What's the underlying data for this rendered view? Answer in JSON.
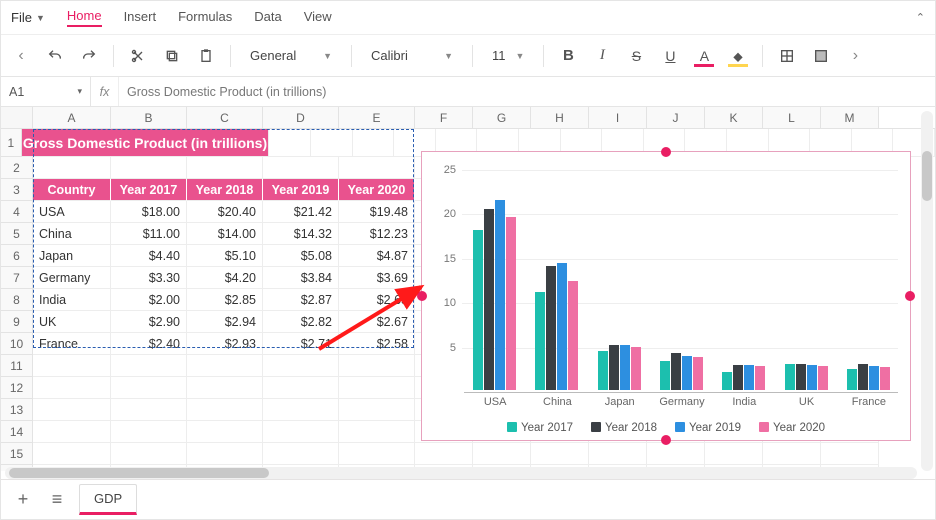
{
  "menu": {
    "file": "File",
    "items": [
      "Home",
      "Insert",
      "Formulas",
      "Data",
      "View"
    ],
    "activeIndex": 0
  },
  "toolbar": {
    "numberFormat": "General",
    "fontName": "Calibri",
    "fontSize": "11"
  },
  "formula": {
    "cellRef": "A1",
    "fx": "fx",
    "value": "Gross Domestic Product (in trillions)"
  },
  "columns": [
    "A",
    "B",
    "C",
    "D",
    "E",
    "F",
    "G",
    "H",
    "I",
    "J",
    "K",
    "L",
    "M"
  ],
  "rowCount": 16,
  "table": {
    "title": "Gross Domestic Product (in trillions)",
    "headers": [
      "Country",
      "Year 2017",
      "Year 2018",
      "Year 2019",
      "Year 2020"
    ],
    "rows": [
      [
        "USA",
        "$18.00",
        "$20.40",
        "$21.42",
        "$19.48"
      ],
      [
        "China",
        "$11.00",
        "$14.00",
        "$14.32",
        "$12.23"
      ],
      [
        "Japan",
        "$4.40",
        "$5.10",
        "$5.08",
        "$4.87"
      ],
      [
        "Germany",
        "$3.30",
        "$4.20",
        "$3.84",
        "$3.69"
      ],
      [
        "India",
        "$2.00",
        "$2.85",
        "$2.87",
        "$2.65"
      ],
      [
        "UK",
        "$2.90",
        "$2.94",
        "$2.82",
        "$2.67"
      ],
      [
        "France",
        "$2.40",
        "$2.93",
        "$2.71",
        "$2.58"
      ]
    ]
  },
  "sheet": {
    "name": "GDP"
  },
  "chart_data": {
    "type": "bar",
    "categories": [
      "USA",
      "China",
      "Japan",
      "Germany",
      "India",
      "UK",
      "France"
    ],
    "series": [
      {
        "name": "Year 2017",
        "color": "#1cbfae",
        "values": [
          18.0,
          11.0,
          4.4,
          3.3,
          2.0,
          2.9,
          2.4
        ]
      },
      {
        "name": "Year 2018",
        "color": "#3a3f44",
        "values": [
          20.4,
          14.0,
          5.1,
          4.2,
          2.85,
          2.94,
          2.93
        ]
      },
      {
        "name": "Year 2019",
        "color": "#2d8fe0",
        "values": [
          21.42,
          14.32,
          5.08,
          3.84,
          2.87,
          2.82,
          2.71
        ]
      },
      {
        "name": "Year 2020",
        "color": "#ef6fa3",
        "values": [
          19.48,
          12.23,
          4.87,
          3.69,
          2.65,
          2.67,
          2.58
        ]
      }
    ],
    "ylim": [
      0,
      25
    ],
    "yticks": [
      5,
      10,
      15,
      20,
      25
    ],
    "xlabel": "",
    "ylabel": "",
    "title": ""
  }
}
